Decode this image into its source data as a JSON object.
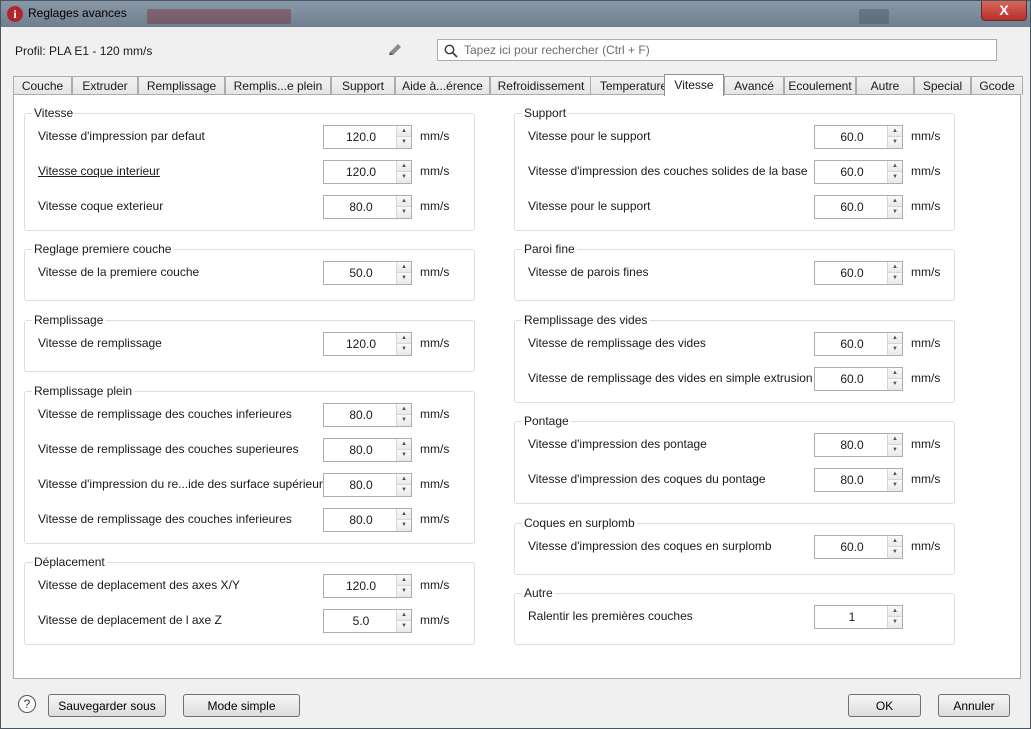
{
  "window": {
    "title": "Reglages avances",
    "app_icon_glyph": "i",
    "close_glyph": "X"
  },
  "profile": {
    "label": "Profil: PLA E1 - 120 mm/s"
  },
  "search": {
    "placeholder": "Tapez ici pour rechercher (Ctrl + F)",
    "value": ""
  },
  "tabs": [
    {
      "label": "Couche",
      "active": false
    },
    {
      "label": "Extruder",
      "active": false
    },
    {
      "label": "Remplissage",
      "active": false
    },
    {
      "label": "Remplis...e plein",
      "active": false
    },
    {
      "label": "Support",
      "active": false
    },
    {
      "label": "Aide à...érence",
      "active": false
    },
    {
      "label": "Refroidissement",
      "active": false
    },
    {
      "label": "Temperature",
      "active": false
    },
    {
      "label": "Vitesse",
      "active": true
    },
    {
      "label": "Avancé",
      "active": false
    },
    {
      "label": "Ecoulement",
      "active": false
    },
    {
      "label": "Autre",
      "active": false
    },
    {
      "label": "Special",
      "active": false
    },
    {
      "label": "Gcode",
      "active": false
    }
  ],
  "left_column": {
    "vitesse": {
      "title": "Vitesse",
      "rows": [
        {
          "label": "Vitesse d'impression par defaut",
          "value": "120.0",
          "unit": "mm/s"
        },
        {
          "label": "Vitesse coque interieur",
          "value": "120.0",
          "unit": "mm/s"
        },
        {
          "label": "Vitesse coque exterieur",
          "value": "80.0",
          "unit": "mm/s"
        }
      ]
    },
    "premiere_couche": {
      "title": "Reglage premiere couche",
      "rows": [
        {
          "label": "Vitesse de la premiere couche",
          "value": "50.0",
          "unit": "mm/s"
        }
      ]
    },
    "remplissage": {
      "title": "Remplissage",
      "rows": [
        {
          "label": "Vitesse de remplissage",
          "value": "120.0",
          "unit": "mm/s"
        }
      ]
    },
    "remplissage_plein": {
      "title": "Remplissage plein",
      "rows": [
        {
          "label": "Vitesse de remplissage des couches inferieures",
          "value": "80.0",
          "unit": "mm/s"
        },
        {
          "label": "Vitesse de remplissage des couches superieures",
          "value": "80.0",
          "unit": "mm/s"
        },
        {
          "label": "Vitesse d'impression du re...ide des surface supérieure",
          "value": "80.0",
          "unit": "mm/s"
        },
        {
          "label": "Vitesse de remplissage des couches inferieures",
          "value": "80.0",
          "unit": "mm/s"
        }
      ]
    },
    "deplacement": {
      "title": "Déplacement",
      "rows": [
        {
          "label": "Vitesse de deplacement des axes X/Y",
          "value": "120.0",
          "unit": "mm/s"
        },
        {
          "label": "Vitesse de deplacement de l axe Z",
          "value": "5.0",
          "unit": "mm/s"
        }
      ]
    }
  },
  "right_column": {
    "support": {
      "title": "Support",
      "rows": [
        {
          "label": "Vitesse pour le support",
          "value": "60.0",
          "unit": "mm/s"
        },
        {
          "label": "Vitesse d'impression des couches solides de la base",
          "value": "60.0",
          "unit": "mm/s"
        },
        {
          "label": "Vitesse pour le support",
          "value": "60.0",
          "unit": "mm/s"
        }
      ]
    },
    "paroi_fine": {
      "title": "Paroi fine",
      "rows": [
        {
          "label": "Vitesse de parois fines",
          "value": "60.0",
          "unit": "mm/s"
        }
      ]
    },
    "remplissage_vides": {
      "title": "Remplissage des vides",
      "rows": [
        {
          "label": "Vitesse de remplissage des vides",
          "value": "60.0",
          "unit": "mm/s"
        },
        {
          "label": "Vitesse de remplissage des vides en simple extrusion",
          "value": "60.0",
          "unit": "mm/s"
        }
      ]
    },
    "pontage": {
      "title": "Pontage",
      "rows": [
        {
          "label": "Vitesse d'impression des pontage",
          "value": "80.0",
          "unit": "mm/s"
        },
        {
          "label": "Vitesse d'impression des coques du pontage",
          "value": "80.0",
          "unit": "mm/s"
        }
      ]
    },
    "surplomb": {
      "title": "Coques en surplomb",
      "rows": [
        {
          "label": "Vitesse d'impression des coques en surplomb",
          "value": "60.0",
          "unit": "mm/s"
        }
      ]
    },
    "autre": {
      "title": "Autre",
      "rows": [
        {
          "label": "Ralentir les premières couches",
          "value": "1",
          "unit": ""
        }
      ]
    }
  },
  "buttons": {
    "help": "?",
    "save_as": "Sauvegarder sous",
    "simple_mode": "Mode simple",
    "ok": "OK",
    "cancel": "Annuler"
  },
  "icons": {
    "spin_up": "▲",
    "spin_down": "▼",
    "edit": "pencil-icon",
    "search": "search-icon"
  }
}
